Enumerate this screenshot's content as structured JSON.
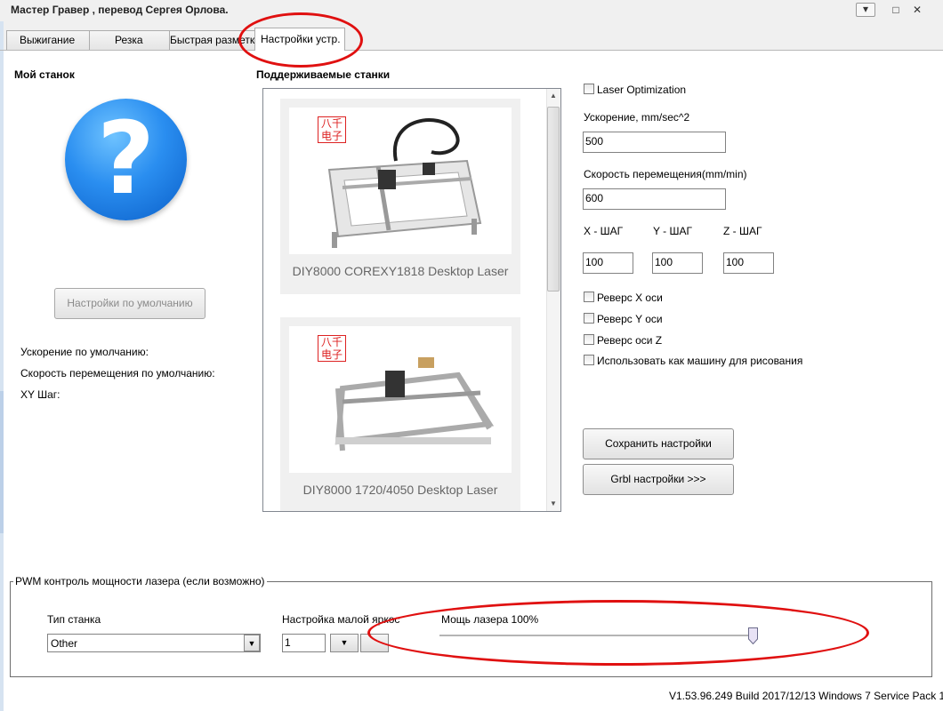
{
  "window": {
    "title": "Мастер Гравер , перевод Сергея Орлова."
  },
  "tabs": [
    {
      "label": "Выжигание"
    },
    {
      "label": "Резка"
    },
    {
      "label": "Быстрая разметка"
    },
    {
      "label": "Настройки устр."
    }
  ],
  "my_machine": {
    "heading": "Мой станок",
    "default_button": "Настройки по умолчанию",
    "info": [
      "Ускорение по умолчанию:",
      "Скорость перемещения по умолчанию:",
      "XY Шаг:"
    ]
  },
  "supported": {
    "heading": "Поддерживаемые станки",
    "machines": [
      {
        "name": "DIY8000 COREXY1818 Desktop Laser",
        "brand": "八千\n电子"
      },
      {
        "name": "DIY8000 1720/4050 Desktop Laser",
        "brand": "八千\n电子"
      }
    ]
  },
  "settings": {
    "laser_optimization": "Laser Optimization",
    "accel_label": "Ускорение, mm/sec^2",
    "accel_value": "500",
    "speed_label": "Скорость перемещения(mm/min)",
    "speed_value": "600",
    "x_step_label": "X - ШАГ",
    "y_step_label": "Y - ШАГ",
    "z_step_label": "Z - ШАГ",
    "x_step": "100",
    "y_step": "100",
    "z_step": "100",
    "checkboxes": [
      "Реверс X оси",
      "Реверс Y оси",
      "Реверс оси Z",
      "Использовать как машину для рисования"
    ],
    "save_button": "Сохранить настройки",
    "grbl_button": "Grbl настройки >>>"
  },
  "pwm": {
    "group_title": "PWM контроль мощности лазера (если возможно)",
    "machine_type_label": "Тип станка",
    "machine_type_value": "Other",
    "low_brightness_label": "Настройка малой яркости",
    "low_brightness_value": "1",
    "power_label": "Мощь лазера 100%",
    "power_fraction": 1.0
  },
  "footer": {
    "version": "V1.53.96.249 Build 2017/12/13 Windows 7 Service Pack 1"
  },
  "colors": {
    "annotation": "#e01010",
    "icon_blue": "#2a8ef0"
  }
}
